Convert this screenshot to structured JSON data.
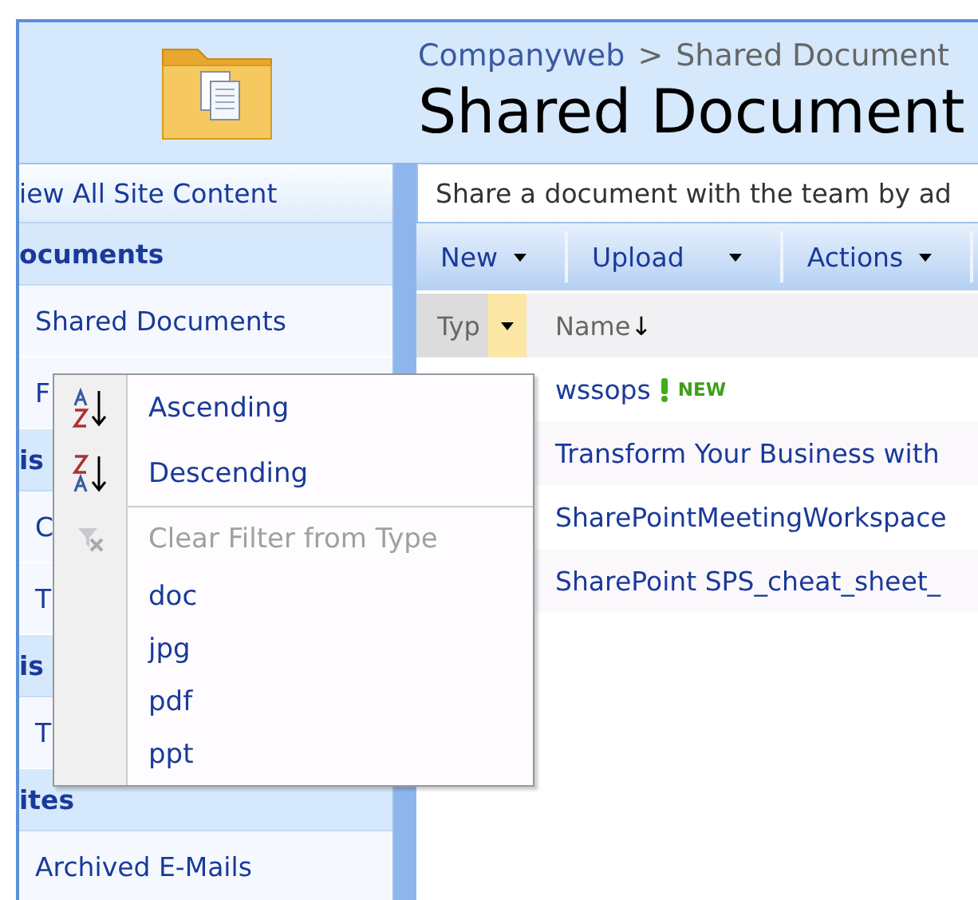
{
  "breadcrumb": {
    "items": [
      "Companyweb",
      "Shared Document"
    ],
    "separator": ">"
  },
  "title": "Shared Document",
  "sidebar": [
    {
      "kind": "link",
      "label": "iew All Site Content"
    },
    {
      "kind": "heading",
      "label": "ocuments"
    },
    {
      "kind": "item",
      "label": "Shared Documents"
    },
    {
      "kind": "item",
      "label": "F"
    },
    {
      "kind": "heading",
      "label": "is"
    },
    {
      "kind": "item",
      "label": "C"
    },
    {
      "kind": "item",
      "label": "T"
    },
    {
      "kind": "heading",
      "label": "is"
    },
    {
      "kind": "item",
      "label": "T"
    },
    {
      "kind": "heading",
      "label": "ites"
    },
    {
      "kind": "item",
      "label": "Archived E-Mails"
    }
  ],
  "description": "Share a document with the team by ad",
  "toolbar": [
    {
      "label": "New"
    },
    {
      "label": "Upload"
    },
    {
      "label": "Actions"
    }
  ],
  "columns": [
    {
      "label": "Typ",
      "filter_open": true
    },
    {
      "label": "Name",
      "sort": "↓"
    }
  ],
  "rows": [
    {
      "name": "wssops",
      "is_new": true,
      "new_label": "NEW"
    },
    {
      "name": "Transform Your Business with"
    },
    {
      "name": "SharePointMeetingWorkspace"
    },
    {
      "name": "SharePoint SPS_cheat_sheet_"
    }
  ],
  "menu": [
    {
      "kind": "sort_asc",
      "label": "Ascending",
      "disabled": false
    },
    {
      "kind": "sort_desc",
      "label": "Descending",
      "disabled": false
    },
    {
      "kind": "clear",
      "label": "Clear Filter from Type",
      "disabled": true
    },
    {
      "kind": "value",
      "label": "doc",
      "disabled": false
    },
    {
      "kind": "value",
      "label": "jpg",
      "disabled": false
    },
    {
      "kind": "value",
      "label": "pdf",
      "disabled": false
    },
    {
      "kind": "value",
      "label": "ppt",
      "disabled": false
    }
  ]
}
